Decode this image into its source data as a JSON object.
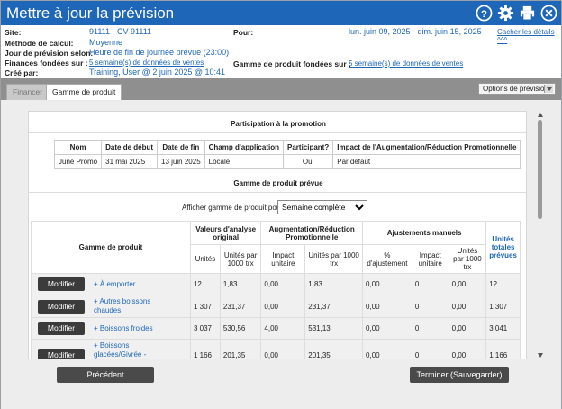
{
  "title": "Mettre à jour la prévision",
  "icons": [
    "help-icon",
    "gear-icon",
    "print-icon",
    "close-icon"
  ],
  "info": {
    "site_label": "Site:",
    "site_value": "91111 - CV 91111",
    "method_label": "Méthode de calcul:",
    "method_value": "Moyenne",
    "forecast_day_label": "Jour de prévision selon:",
    "forecast_day_value": "Heure de fin de journée prévue (23:00)",
    "finances_label": "Finances fondées sur :",
    "finances_value": "5 semaine(s) de données de ventes",
    "created_label": "Créé par:",
    "created_value": "Training, User @ 2 juin 2025 @ 10:41",
    "for_label": "Pour:",
    "for_value": "lun. juin 09, 2025 - dim. juin 15, 2025",
    "hide_details": "Cacher les détails ^^^",
    "gamme_label": "Gamme de produit fondées sur :",
    "gamme_value": "5 semaine(s) de données de ventes"
  },
  "tabs": [
    {
      "label": "Financer"
    },
    {
      "label": "Gamme de produit"
    }
  ],
  "options_label": "Options de prévision",
  "promo": {
    "heading": "Participation à la promotion",
    "headers": [
      "Nom",
      "Date de début",
      "Date de fin",
      "Champ d'application",
      "Participant?",
      "Impact de l'Augmentation/Réduction Promotionnelle"
    ],
    "row": [
      "June Promo",
      "31 mai 2025",
      "13 juin 2025",
      "Locale",
      "Oui",
      "Par défaut"
    ]
  },
  "gamme": {
    "heading": "Gamme de produit prévue",
    "filter_label": "Afficher gamme de produit pour:",
    "filter_value": "Semaine complète",
    "group_headers": {
      "product": "Gamme de produit",
      "analysis": "Valeurs d'analyse original",
      "promo": "Augmentation/Réduction Promotionnelle",
      "manual": "Ajustements manuels",
      "total": "Unités totales prévues"
    },
    "sub_headers": [
      "Unités",
      "Unités par 1000 trx",
      "Impact unitaire",
      "Unités par 1000 trx",
      "% d'ajustement",
      "Impact unitaire",
      "Unités par 1000 trx"
    ],
    "modify_label": "Modifier",
    "rows": [
      {
        "product": "+ À emporter",
        "cells": [
          "12",
          "1,83",
          "0,00",
          "1,83",
          "0,00",
          "0",
          "0,00",
          "12"
        ]
      },
      {
        "product": "+ Autres boissons chaudes",
        "cells": [
          "1 307",
          "231,37",
          "0,00",
          "231,37",
          "0,00",
          "0",
          "0,00",
          "1 307"
        ]
      },
      {
        "product": "+ Boissons froides",
        "cells": [
          "3 037",
          "530,56",
          "4,00",
          "531,13",
          "0,00",
          "0",
          "0,00",
          "3 041"
        ]
      },
      {
        "product": "+ Boissons glacées/Givrée -modif",
        "cells": [
          "1 166",
          "201,35",
          "0,00",
          "201,35",
          "0,00",
          "0",
          "0,00",
          "1 166"
        ]
      }
    ]
  },
  "buttons": {
    "previous": "Précédent",
    "finish": "Terminer (Sauvegarder)"
  }
}
